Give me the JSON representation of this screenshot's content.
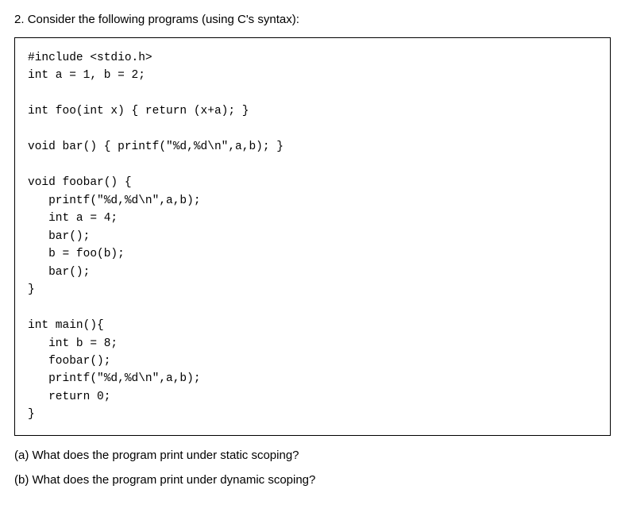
{
  "question": {
    "number": "2.",
    "intro": "Consider the following programs (using C's syntax):"
  },
  "code": {
    "line1": "#include <stdio.h>",
    "line2": "int a = 1, b = 2;",
    "line3": "",
    "line4": "int foo(int x) { return (x+a); }",
    "line5": "",
    "line6": "void bar() { printf(\"%d,%d\\n\",a,b); }",
    "line7": "",
    "line8": "void foobar() {",
    "line9": "   printf(\"%d,%d\\n\",a,b);",
    "line10": "   int a = 4;",
    "line11": "   bar();",
    "line12": "   b = foo(b);",
    "line13": "   bar();",
    "line14": "}",
    "line15": "",
    "line16": "int main(){",
    "line17": "   int b = 8;",
    "line18": "   foobar();",
    "line19": "   printf(\"%d,%d\\n\",a,b);",
    "line20": "   return 0;",
    "line21": "}"
  },
  "subquestions": {
    "a": "(a) What does the program print under static scoping?",
    "b": "(b) What does the program print under dynamic scoping?"
  }
}
